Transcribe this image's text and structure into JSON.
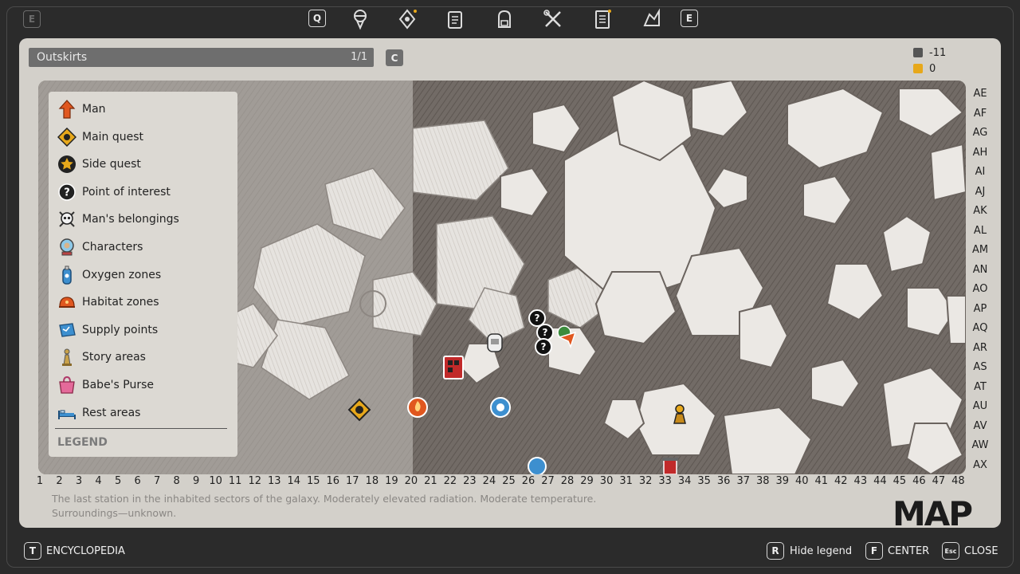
{
  "topbar": {
    "left_key": "E",
    "prev_key": "Q",
    "next_key": "E",
    "tabs": [
      {
        "icon": "character-icon"
      },
      {
        "icon": "location-marker-icon"
      },
      {
        "icon": "clipboard-icon"
      },
      {
        "icon": "backpack-icon"
      },
      {
        "icon": "crossed-tools-icon"
      },
      {
        "icon": "journal-icon"
      },
      {
        "icon": "map-explorer-icon"
      }
    ]
  },
  "location": {
    "name": "Outskirts",
    "page": "1/1",
    "cycle_key": "C"
  },
  "stats": {
    "temperature": "-11",
    "radiation": "0"
  },
  "legend": {
    "title": "LEGEND",
    "items": [
      {
        "label": "Man",
        "icon": "arrow-up-icon"
      },
      {
        "label": "Main quest",
        "icon": "main-quest-icon"
      },
      {
        "label": "Side quest",
        "icon": "star-icon"
      },
      {
        "label": "Point of interest",
        "icon": "question-icon"
      },
      {
        "label": "Man's belongings",
        "icon": "skull-icon"
      },
      {
        "label": "Characters",
        "icon": "character-globe-icon"
      },
      {
        "label": "Oxygen zones",
        "icon": "oxygen-tank-icon"
      },
      {
        "label": "Habitat zones",
        "icon": "habitat-icon"
      },
      {
        "label": "Supply points",
        "icon": "supply-icon"
      },
      {
        "label": "Story areas",
        "icon": "statue-icon"
      },
      {
        "label": "Babe's Purse",
        "icon": "purse-icon"
      },
      {
        "label": "Rest areas",
        "icon": "bed-icon"
      }
    ]
  },
  "grid": {
    "rows": [
      "AE",
      "AF",
      "AG",
      "AH",
      "AI",
      "AJ",
      "AK",
      "AL",
      "AM",
      "AN",
      "AO",
      "AP",
      "AQ",
      "AR",
      "AS",
      "AT",
      "AU",
      "AV",
      "AW",
      "AX"
    ],
    "cols": [
      "1",
      "2",
      "3",
      "4",
      "5",
      "6",
      "7",
      "8",
      "9",
      "10",
      "11",
      "12",
      "13",
      "14",
      "15",
      "16",
      "17",
      "18",
      "19",
      "20",
      "21",
      "22",
      "23",
      "24",
      "25",
      "26",
      "27",
      "28",
      "29",
      "30",
      "31",
      "32",
      "33",
      "34",
      "35",
      "36",
      "37",
      "38",
      "39",
      "40",
      "41",
      "42",
      "43",
      "44",
      "45",
      "46",
      "47",
      "48"
    ]
  },
  "description": "The last station in the inhabited sectors of the galaxy. Moderately elevated radiation. Moderate temperature. Surroundings—unknown.",
  "map_title": "MAP",
  "bottombar": {
    "encyclopedia_key": "T",
    "encyclopedia_label": "ENCYCLOPEDIA",
    "legend_key": "R",
    "legend_label": "Hide legend",
    "center_key": "F",
    "center_label": "CENTER",
    "close_key": "Esc",
    "close_label": "CLOSE"
  },
  "colors": {
    "accent_orange": "#e0571f",
    "quest_gold": "#e7a81b",
    "paper": "#d3d0ca"
  }
}
